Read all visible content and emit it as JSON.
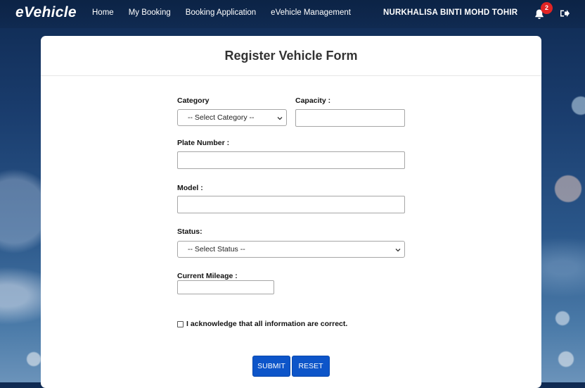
{
  "brand": "eVehicle",
  "nav": {
    "items": [
      {
        "label": "Home"
      },
      {
        "label": "My Booking"
      },
      {
        "label": "Booking Application"
      },
      {
        "label": "eVehicle Management"
      }
    ],
    "user_name": "NURKHALISA BINTI MOHD TOHIR",
    "notification_count": "2",
    "icons": {
      "notifications": "bell-icon",
      "logout": "logout-icon"
    }
  },
  "form": {
    "title": "Register Vehicle Form",
    "category": {
      "label": "Category",
      "selected": "-- Select Category --"
    },
    "capacity": {
      "label": "Capacity :",
      "value": ""
    },
    "plate_number": {
      "label": "Plate Number :",
      "value": ""
    },
    "model": {
      "label": "Model :",
      "value": ""
    },
    "status": {
      "label": "Status:",
      "selected": "-- Select Status --"
    },
    "current_mileage": {
      "label": "Current Mileage :",
      "value": ""
    },
    "acknowledge": {
      "label": "I acknowledge that all information are correct.",
      "checked": false
    },
    "submit_label": "SUBMIT",
    "reset_label": "RESET"
  },
  "colors": {
    "primary_button": "#0d55c9",
    "badge": "#e02424",
    "nav_text": "#ffffff"
  }
}
